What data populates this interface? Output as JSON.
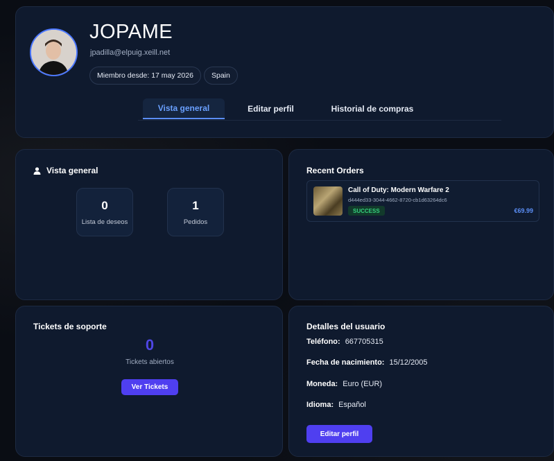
{
  "profile": {
    "username": "JOPAME",
    "email": "jpadilla@elpuig.xeill.net",
    "member_since": "Miembro desde: 17 may 2026",
    "country": "Spain"
  },
  "tabs": [
    {
      "label": "Vista general",
      "active": true
    },
    {
      "label": "Editar perfil",
      "active": false
    },
    {
      "label": "Historial de compras",
      "active": false
    }
  ],
  "overview": {
    "title": "Vista general",
    "icon": "user-icon",
    "stats": [
      {
        "value": "0",
        "label": "Lista de deseos"
      },
      {
        "value": "1",
        "label": "Pedidos"
      }
    ]
  },
  "orders": {
    "title": "Recent Orders",
    "items": [
      {
        "title": "Call of Duty: Modern Warfare 2",
        "id": "d444ed33-3044-4662-8720-cb1d63264dc6",
        "status": "SUCCESS",
        "price": "€69.99"
      }
    ]
  },
  "tickets": {
    "title": "Tickets de soporte",
    "count": "0",
    "label": "Tickets abiertos",
    "button": "Ver Tickets"
  },
  "details": {
    "title": "Detalles del usuario",
    "rows": [
      {
        "label": "Teléfono:",
        "value": "667705315"
      },
      {
        "label": "Fecha de nacimiento:",
        "value": "15/12/2005"
      },
      {
        "label": "Moneda:",
        "value": "Euro (EUR)"
      },
      {
        "label": "Idioma:",
        "value": "Español"
      }
    ],
    "button": "Editar perfil"
  },
  "colors": {
    "accent": "#4f3ff0",
    "link": "#5b8ef5",
    "success": "#34d17c",
    "card_bg": "#0f1a2e"
  }
}
